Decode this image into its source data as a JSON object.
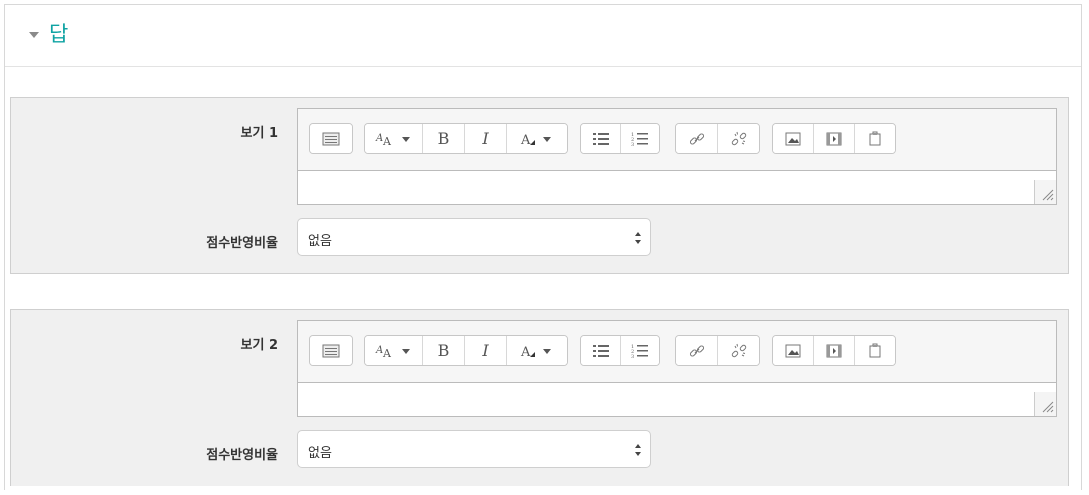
{
  "section": {
    "title": "답"
  },
  "choices": [
    {
      "label": "보기 1",
      "grade_label": "점수반영비율",
      "grade_value": "없음"
    },
    {
      "label": "보기 2",
      "grade_label": "점수반영비율",
      "grade_value": "없음"
    }
  ],
  "toolbar": {
    "bold": "B",
    "italic": "I",
    "icons": [
      "toggle-toolbar-icon",
      "paragraph-styles-icon",
      "bold-icon",
      "italic-icon",
      "text-color-icon",
      "unordered-list-icon",
      "ordered-list-icon",
      "link-icon",
      "unlink-icon",
      "image-icon",
      "media-icon",
      "file-manager-icon"
    ]
  }
}
